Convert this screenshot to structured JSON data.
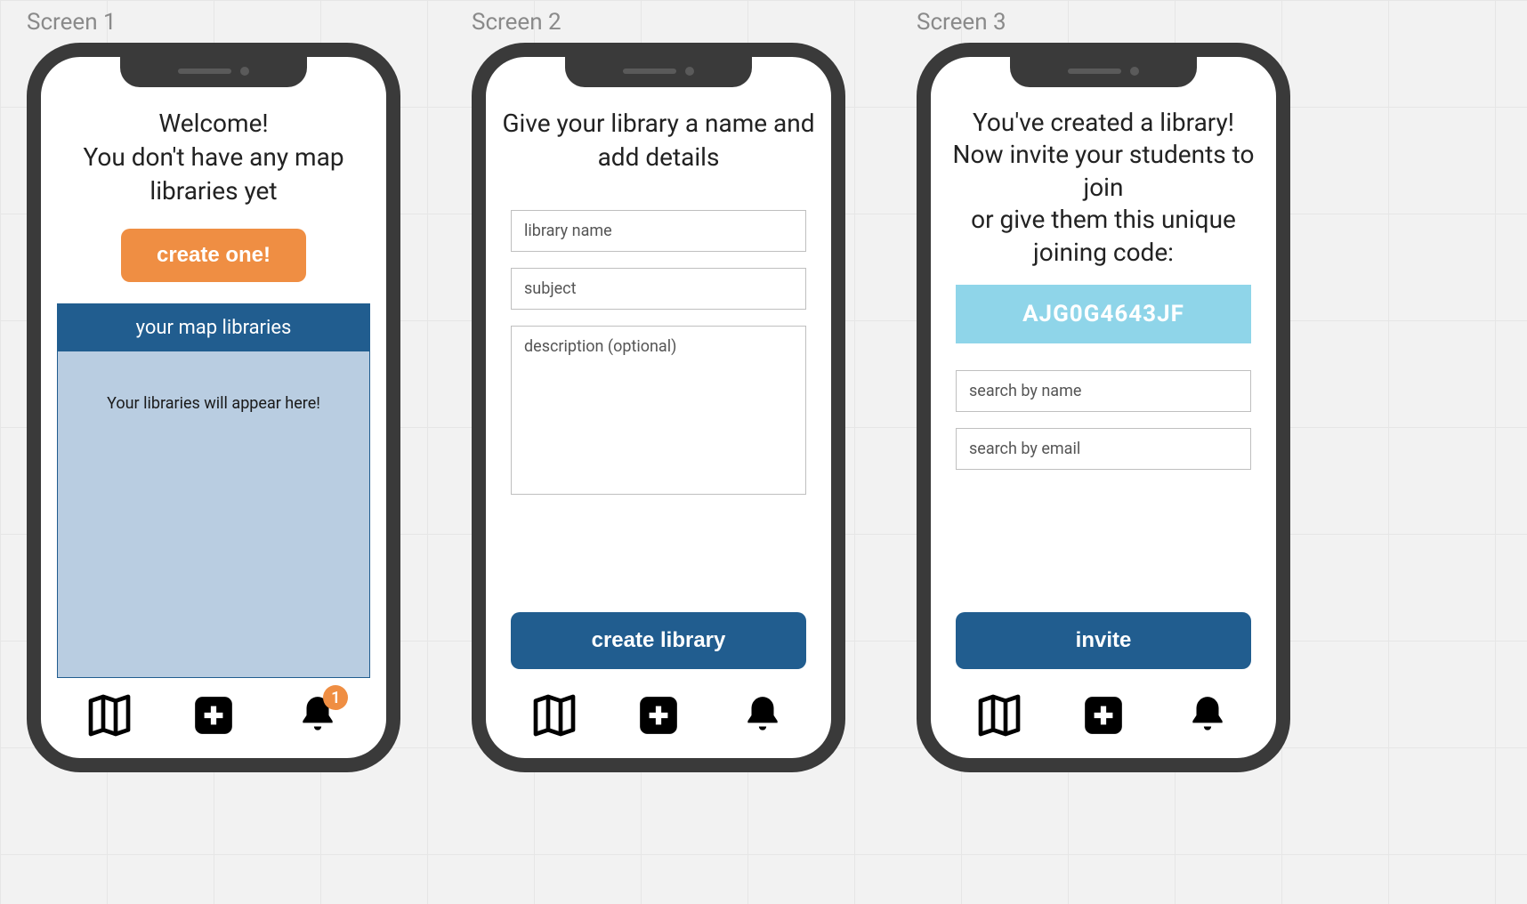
{
  "labels": {
    "screen1": "Screen 1",
    "screen2": "Screen 2",
    "screen3": "Screen 3"
  },
  "screen1": {
    "heading": "Welcome!\nYou don't have any map libraries yet",
    "create_button": "create one!",
    "panel_title": "your map libraries",
    "panel_empty_text": "Your libraries will appear here!",
    "notification_count": "1"
  },
  "screen2": {
    "heading": "Give your library a name and add details",
    "name_placeholder": "library name",
    "subject_placeholder": "subject",
    "description_placeholder": "description (optional)",
    "submit_button": "create library"
  },
  "screen3": {
    "heading": "You've created a library! Now invite your students to join\nor give them this unique joining code:",
    "code": "AJG0G4643JF",
    "search_name_placeholder": "search by name",
    "search_email_placeholder": "search by email",
    "invite_button": "invite"
  },
  "nav": {
    "map_icon": "map-icon",
    "add_icon": "plus-icon",
    "bell_icon": "bell-icon"
  }
}
